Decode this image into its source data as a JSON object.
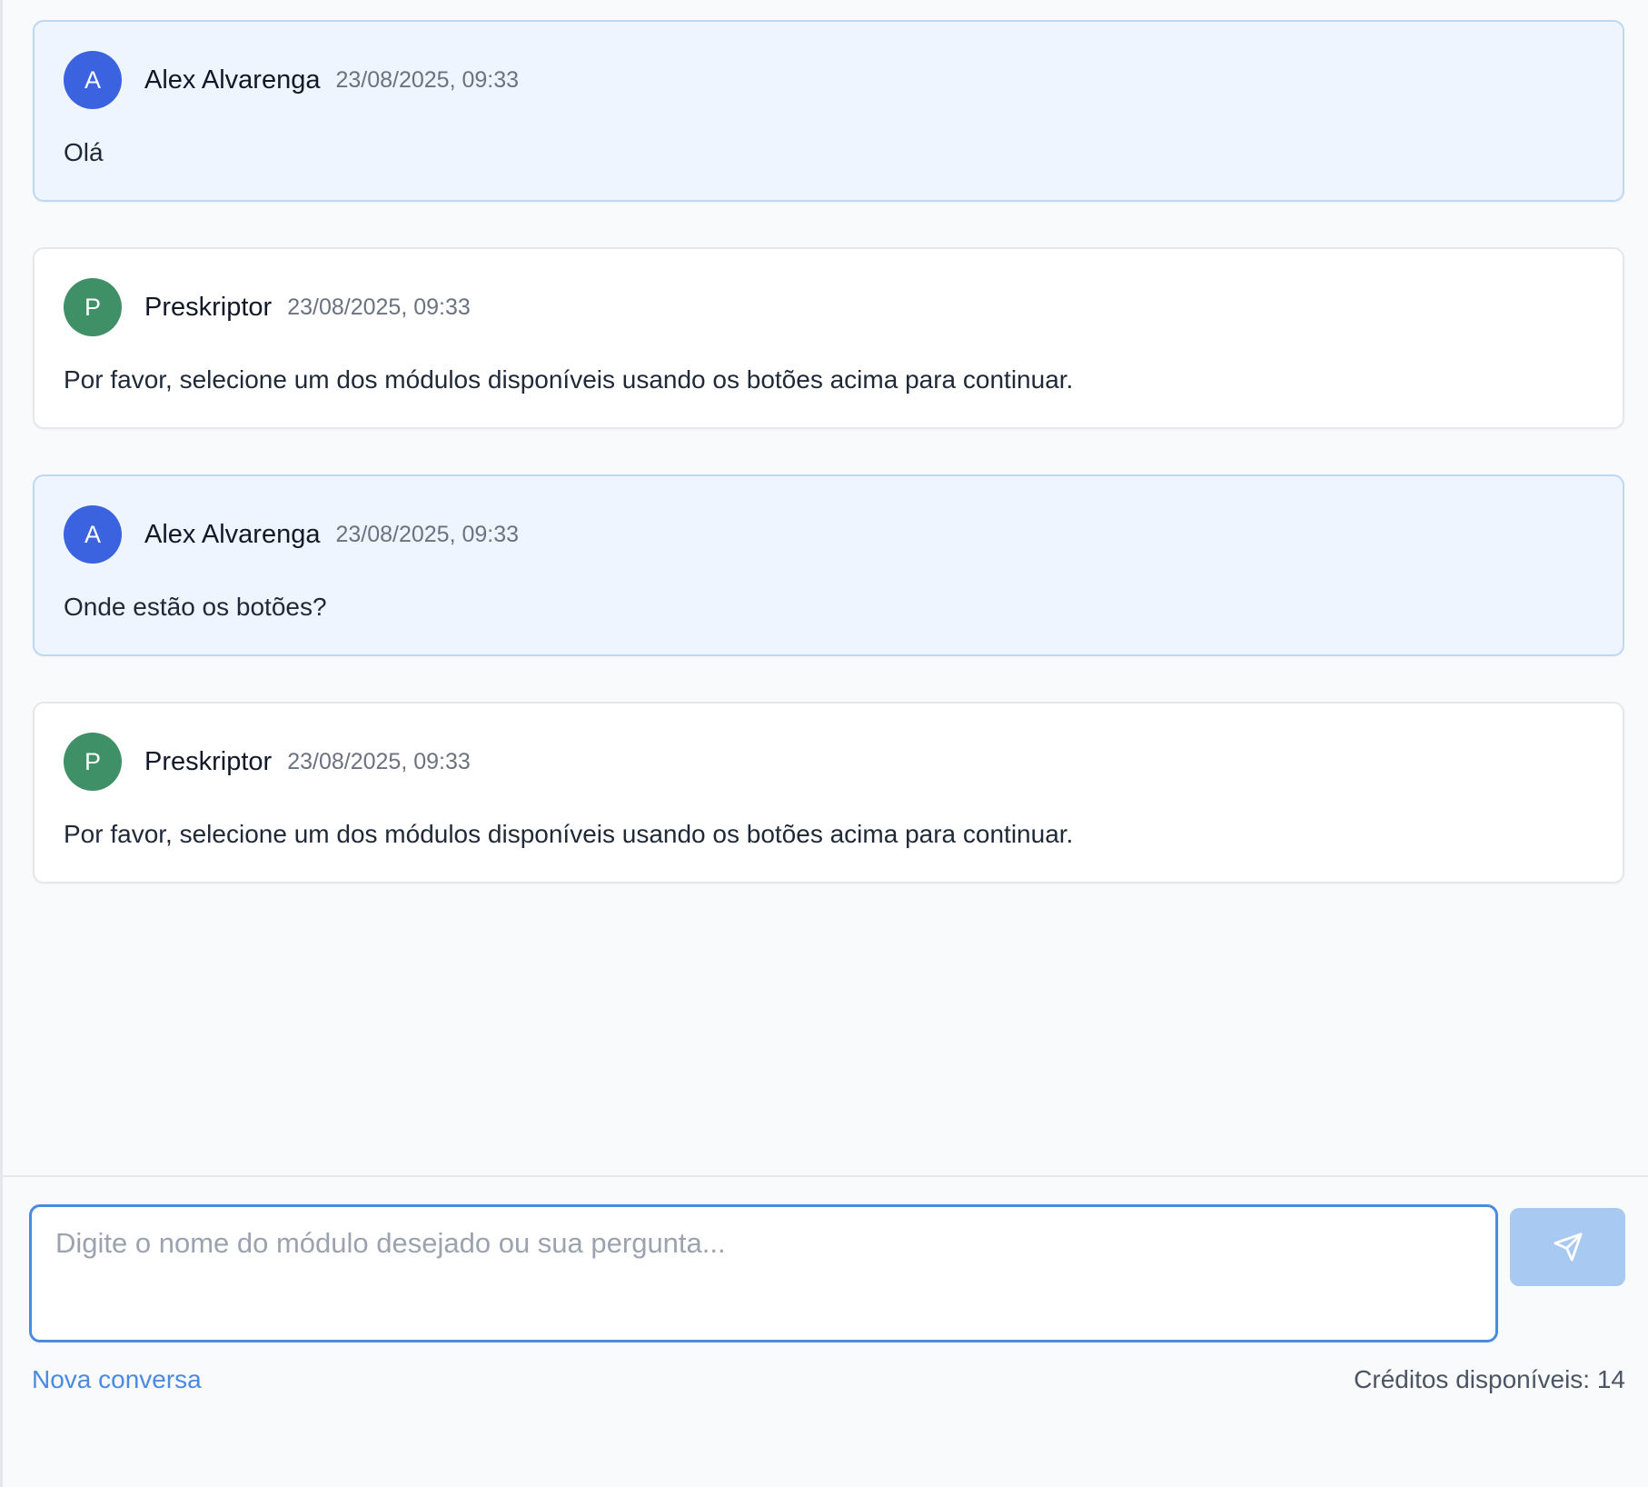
{
  "messages": [
    {
      "role": "user",
      "avatar_letter": "A",
      "author": "Alex Alvarenga",
      "timestamp": "23/08/2025, 09:33",
      "text": "Olá"
    },
    {
      "role": "bot",
      "avatar_letter": "P",
      "author": "Preskriptor",
      "timestamp": "23/08/2025, 09:33",
      "text": "Por favor, selecione um dos módulos disponíveis usando os botões acima para continuar."
    },
    {
      "role": "user",
      "avatar_letter": "A",
      "author": "Alex Alvarenga",
      "timestamp": "23/08/2025, 09:33",
      "text": "Onde estão os botões?"
    },
    {
      "role": "bot",
      "avatar_letter": "P",
      "author": "Preskriptor",
      "timestamp": "23/08/2025, 09:33",
      "text": "Por favor, selecione um dos módulos disponíveis usando os botões acima para continuar."
    }
  ],
  "composer": {
    "placeholder": "Digite o nome do módulo desejado ou sua pergunta...",
    "value": "",
    "send_icon": "send-icon"
  },
  "footer": {
    "new_conversation_label": "Nova conversa",
    "credits_text": "Créditos disponíveis: 14"
  },
  "colors": {
    "user_avatar": "#3b63e0",
    "bot_avatar": "#3f8f67",
    "accent": "#4a8ae0",
    "user_bubble_bg": "#eef5fe"
  }
}
